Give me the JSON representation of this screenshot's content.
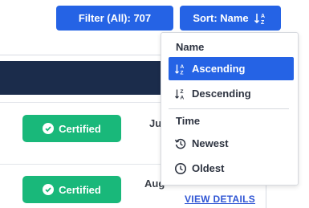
{
  "toolbar": {
    "filter_label": "Filter (All): 707",
    "sort_label": "Sort:  Name"
  },
  "rows": [
    {
      "badge": "Certified",
      "date_fragment": "Ju"
    },
    {
      "badge": "Certified",
      "date_fragment": "Aug",
      "link": "VIEW DETAILS"
    }
  ],
  "sort_menu": {
    "name_header": "Name",
    "ascending": "Ascending",
    "descending": "Descending",
    "time_header": "Time",
    "newest": "Newest",
    "oldest": "Oldest",
    "selected": "Ascending"
  },
  "colors": {
    "primary": "#2563e5",
    "navy": "#1b2c4b",
    "certified": "#19b87a",
    "link": "#2f55d4"
  }
}
